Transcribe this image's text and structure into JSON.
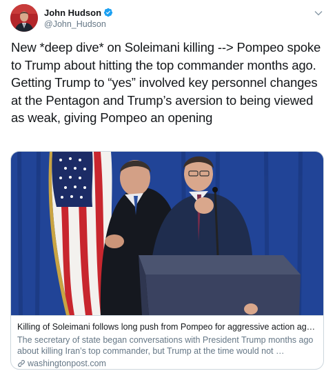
{
  "author": {
    "name": "John Hudson",
    "handle": "@John_Hudson",
    "verified": true
  },
  "tweet": {
    "text": "New *deep dive* on Soleimani killing --> Pompeo spoke to Trump about hitting the top commander months ago. Getting Trump to “yes” involved key personnel changes at the Pentagon and Trump’s aversion to being viewed as weak, giving Pompeo an opening"
  },
  "card": {
    "title": "Killing of Soleimani follows long push from Pompeo for aggressive action agai…",
    "description": "The secretary of state began conversations with President Trump months ago about killing Iran’s top commander, but Trump at the time would not …",
    "domain": "washingtonpost.com"
  },
  "icons": {
    "verified": "verified-badge-icon",
    "caret": "chevron-down-icon",
    "link": "link-icon"
  },
  "colors": {
    "verified_blue": "#1da1f2",
    "secondary_text": "#657786",
    "border": "#ccd6dd"
  }
}
